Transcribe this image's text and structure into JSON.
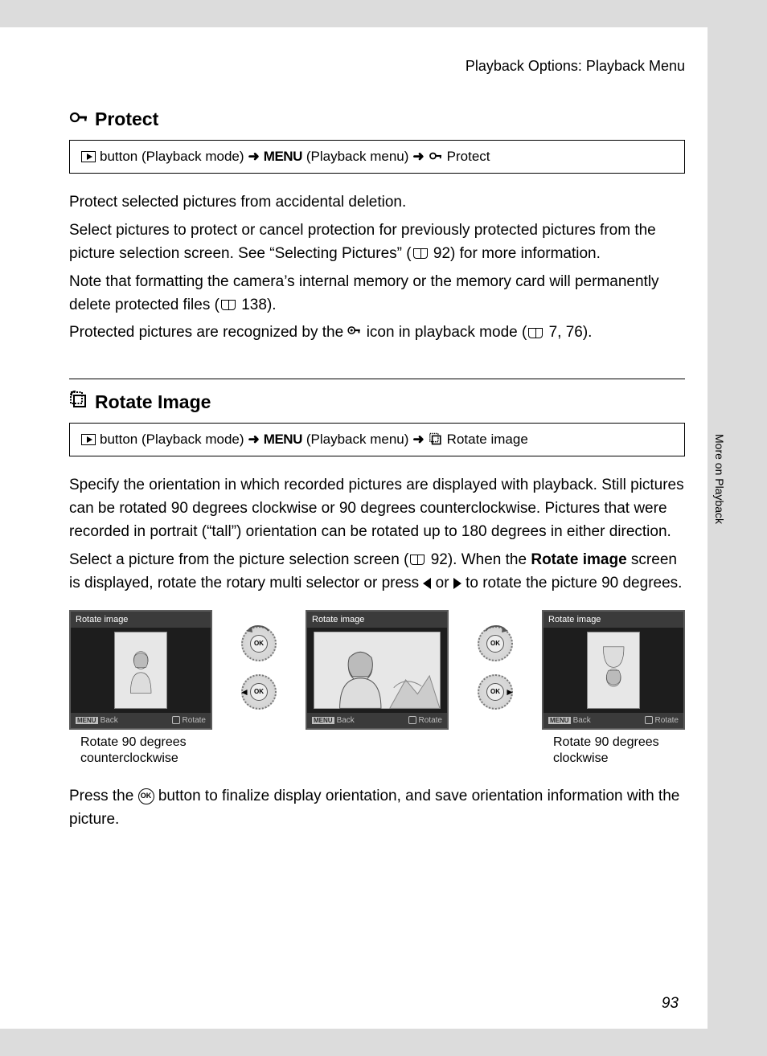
{
  "header": "Playback Options: Playback Menu",
  "side_label": "More on Playback",
  "page_number": "93",
  "protect": {
    "title": "Protect",
    "nav": {
      "step1": "button (Playback mode)",
      "step2": "(Playback menu)",
      "step3": "Protect"
    },
    "p1": "Protect selected pictures from accidental deletion.",
    "p2a": "Select pictures to protect or cancel protection for previously protected pictures from the picture selection screen. See “Selecting Pictures” (",
    "p2_ref": "92",
    "p2b": ") for more information.",
    "p3a": "Note that formatting the camera’s internal memory or the memory card will permanently delete protected files (",
    "p3_ref": "138",
    "p3b": ").",
    "p4a": "Protected pictures are recognized by the ",
    "p4b": " icon in playback mode (",
    "p4_ref": "7, 76",
    "p4c": ")."
  },
  "rotate": {
    "title": "Rotate Image",
    "nav": {
      "step1": "button (Playback mode)",
      "step2": "(Playback menu)",
      "step3": "Rotate image"
    },
    "p1": "Specify the orientation in which recorded pictures are displayed with playback. Still pictures can be rotated 90 degrees clockwise or 90 degrees counterclockwise. Pictures that were recorded in portrait (“tall”) orientation can be rotated up to 180 degrees in either direction.",
    "p2a": "Select a picture from the picture selection screen (",
    "p2_ref": "92",
    "p2b": "). When the ",
    "p2_bold": "Rotate image",
    "p2c": " screen is displayed, rotate the rotary multi selector or press ",
    "p2d": " or ",
    "p2e": " to rotate the picture 90 degrees.",
    "screens": {
      "title": "Rotate image",
      "back": "Back",
      "rotate": "Rotate",
      "menu_chip": "MENU",
      "ok": "OK",
      "caption_ccw_l1": "Rotate 90 degrees",
      "caption_ccw_l2": "counterclockwise",
      "caption_cw_l1": "Rotate 90 degrees",
      "caption_cw_l2": "clockwise"
    },
    "p3a": "Press the ",
    "p3b": " button to finalize display orientation, and save orientation information with the picture."
  },
  "glyphs": {
    "arrow": "➜",
    "ok": "OK",
    "menu": "MENU"
  }
}
